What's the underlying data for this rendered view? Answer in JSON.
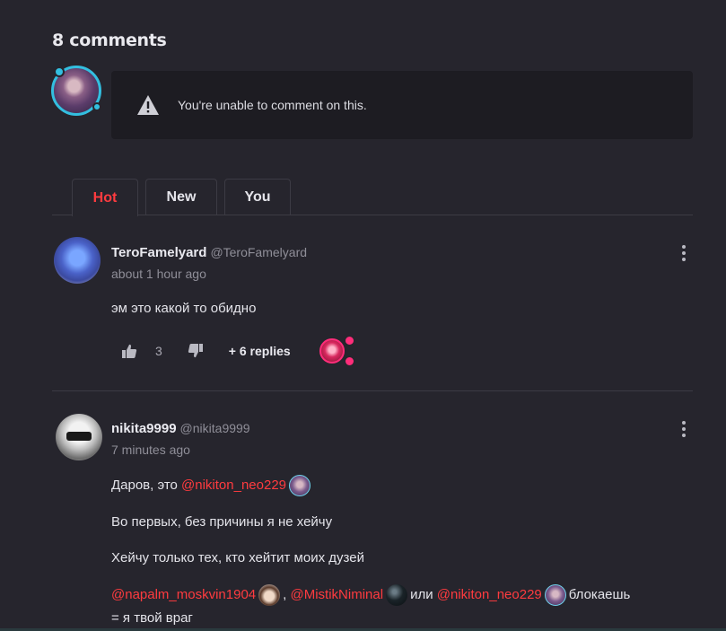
{
  "comments_header": {
    "title": "8 comments"
  },
  "compose": {
    "notice": "You're unable to comment on this."
  },
  "tabs": [
    {
      "label": "Hot",
      "active": true
    },
    {
      "label": "New",
      "active": false
    },
    {
      "label": "You",
      "active": false
    }
  ],
  "colors": {
    "accent": "#ff3b3f",
    "background": "#26252d",
    "panel": "#1d1c22",
    "avatar_ring": "#33bfe0"
  },
  "comments": [
    {
      "author": "TeroFamelyard",
      "handle": "@TeroFamelyard",
      "time": "about 1 hour ago",
      "text": "эм это какой то обидно",
      "likes": "3",
      "replies_label": "+ 6 replies"
    },
    {
      "author": "nikita9999",
      "handle": "@nikita9999",
      "time": "7 minutes ago",
      "lines": {
        "l1_prefix": "Даров, это",
        "l1_mention": "@nikiton_neo229",
        "l2": "Во первых, без причины я не хейчу",
        "l3": "Хейчу только тех, кто хейтит моих дузей",
        "l4_mention1": "@napalm_moskvin1904",
        "l4_sep": ",",
        "l4_mention2": "@MistikNiminal",
        "l4_or": "или",
        "l4_mention3": "@nikiton_neo229",
        "l4_suffix": "блокаешь",
        "l5": "= я  твой враг"
      }
    }
  ],
  "icons": [
    "warning-icon",
    "like-icon",
    "dislike-icon",
    "more-options-icon",
    "heart-icon"
  ]
}
